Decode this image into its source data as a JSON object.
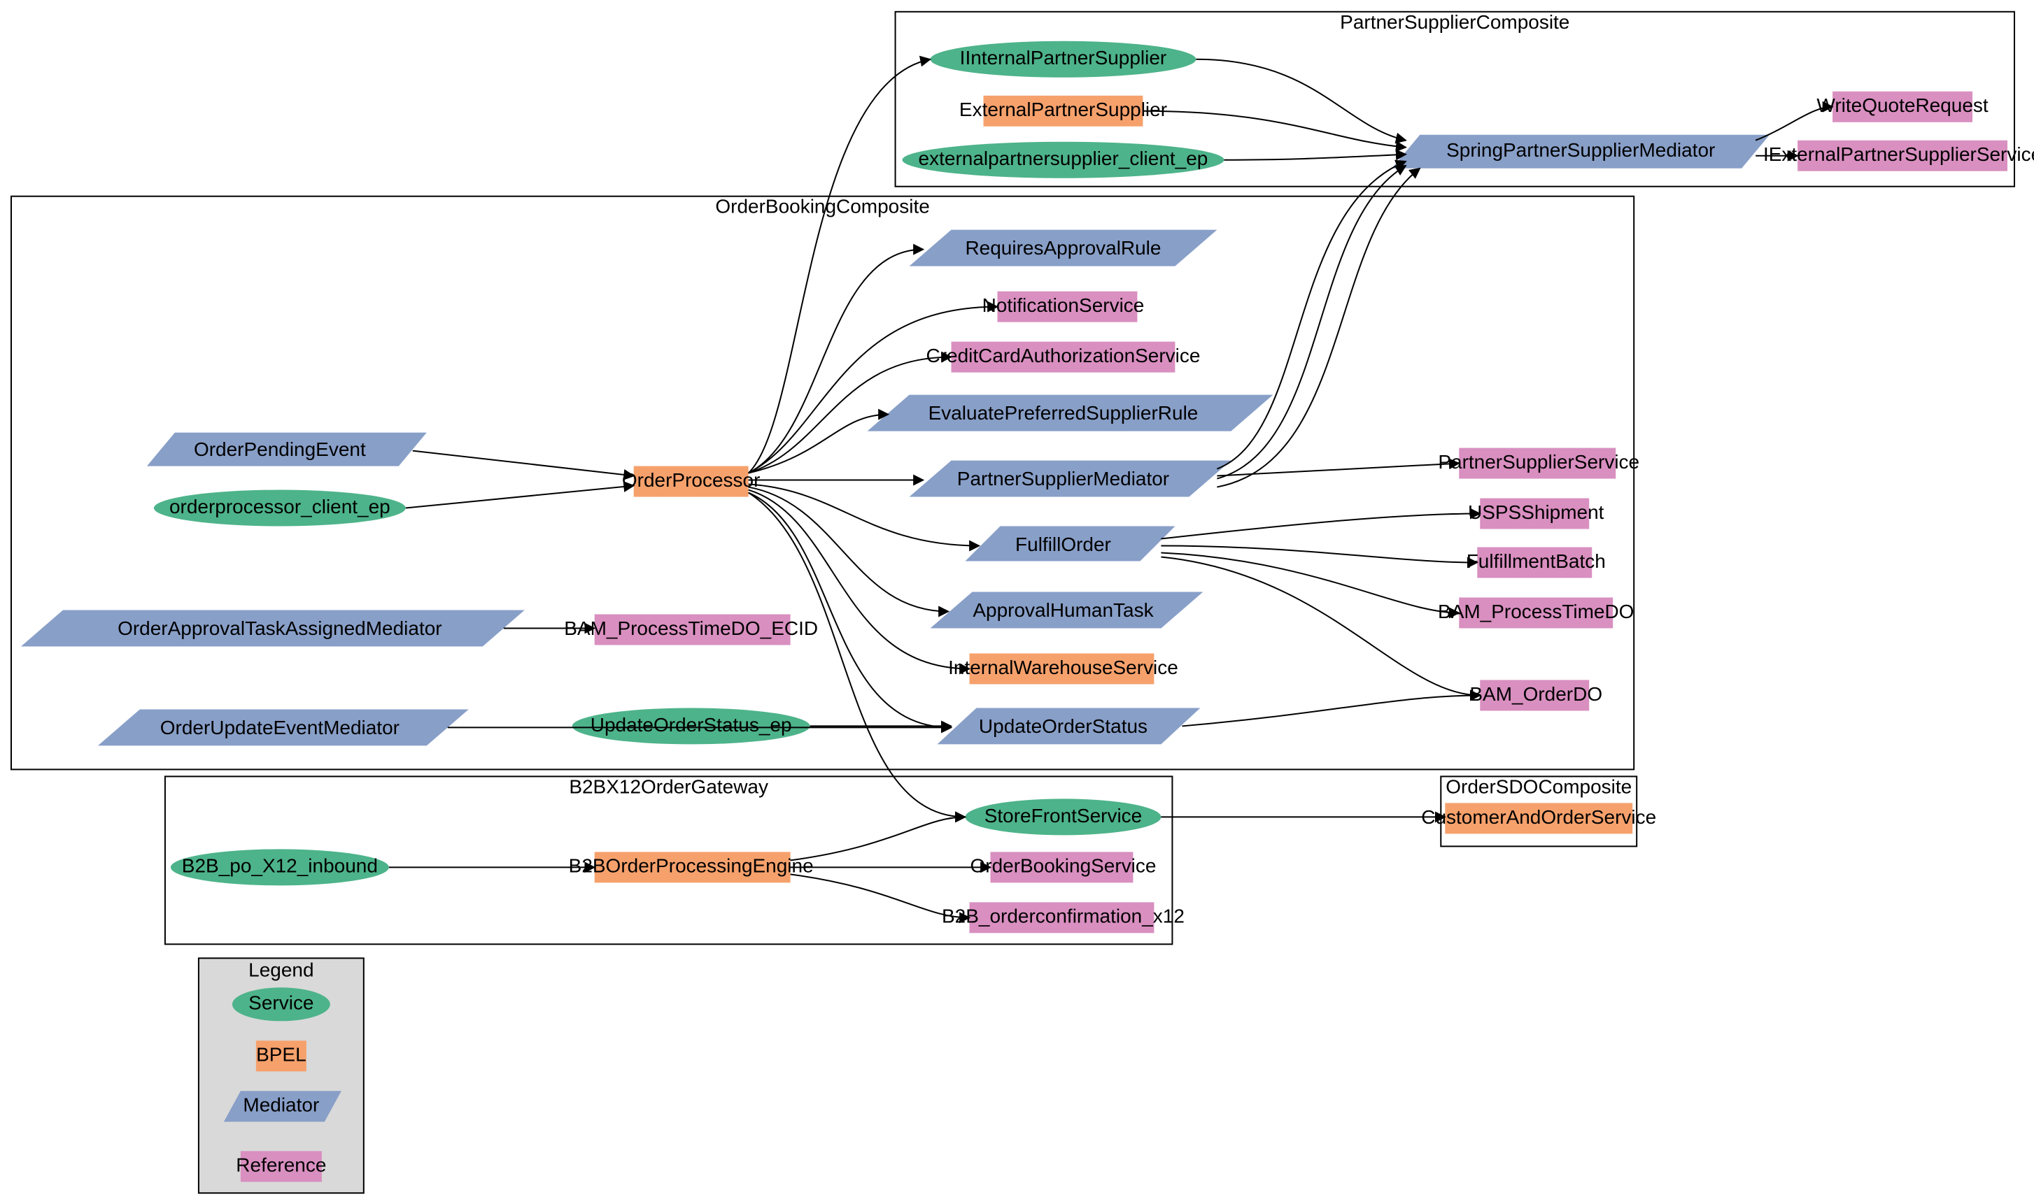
{
  "clusters": {
    "partnerSupplierComposite": "PartnerSupplierComposite",
    "orderBookingComposite": "OrderBookingComposite",
    "b2bGateway": "B2BX12OrderGateway",
    "orderSDOComposite": "OrderSDOComposite",
    "legend": "Legend"
  },
  "nodes": {
    "iinternalPS": "IInternalPartnerSupplier",
    "externalPS": "ExternalPartnerSupplier",
    "extPSclient": "externalpartnersupplier_client_ep",
    "springPSMediator": "SpringPartnerSupplierMediator",
    "writeQuoteReq": "WriteQuoteRequest",
    "iExtPSService": "IExternalPartnerSupplierService",
    "orderPendingEvent": "OrderPendingEvent",
    "orderprocClient": "orderprocessor_client_ep",
    "orderProcessor": "OrderProcessor",
    "requiresApproval": "RequiresApprovalRule",
    "notificationSvc": "NotificationService",
    "ccAuthSvc": "CreditCardAuthorizationService",
    "evalPrefSupplier": "EvaluatePreferredSupplierRule",
    "psMediator": "PartnerSupplierMediator",
    "fulfillOrder": "FulfillOrder",
    "approvalHT": "ApprovalHumanTask",
    "internalWH": "InternalWarehouseService",
    "updateOrderStatus": "UpdateOrderStatus",
    "orderApprovalTAM": "OrderApprovalTaskAssignedMediator",
    "bamECID": "BAM_ProcessTimeDO_ECID",
    "orderUpdateEvtMed": "OrderUpdateEventMediator",
    "updateOrderStatusEp": "UpdateOrderStatus_ep",
    "partnerSupplierSvc": "PartnerSupplierService",
    "uspsShipment": "USPSShipment",
    "fulfillmentBatch": "FulfillmentBatch",
    "bamProcessTimeDO": "BAM_ProcessTimeDO",
    "bamOrderDO": "BAM_OrderDO",
    "b2bInbound": "B2B_po_X12_inbound",
    "b2bEngine": "B2BOrderProcessingEngine",
    "storeFrontSvc": "StoreFrontService",
    "orderBookingSvc": "OrderBookingService",
    "b2bConfirm": "B2B_orderconfirmation_x12",
    "custOrderSvc": "CustomerAndOrderService"
  },
  "legendItems": {
    "service": "Service",
    "bpel": "BPEL",
    "mediator": "Mediator",
    "reference": "Reference"
  },
  "diagram_data": {
    "type": "graph",
    "node_types": {
      "Service": "ellipse, green",
      "BPEL": "rectangle, orange",
      "Mediator": "parallelogram, blue",
      "Reference": "rectangle, pink"
    },
    "clusters": [
      {
        "name": "PartnerSupplierComposite",
        "nodes": [
          {
            "id": "IInternalPartnerSupplier",
            "type": "Service"
          },
          {
            "id": "ExternalPartnerSupplier",
            "type": "BPEL"
          },
          {
            "id": "externalpartnersupplier_client_ep",
            "type": "Service"
          },
          {
            "id": "SpringPartnerSupplierMediator",
            "type": "Mediator"
          },
          {
            "id": "WriteQuoteRequest",
            "type": "Reference"
          },
          {
            "id": "IExternalPartnerSupplierService",
            "type": "Reference"
          }
        ]
      },
      {
        "name": "OrderBookingComposite",
        "nodes": [
          {
            "id": "OrderPendingEvent",
            "type": "Mediator"
          },
          {
            "id": "orderprocessor_client_ep",
            "type": "Service"
          },
          {
            "id": "OrderProcessor",
            "type": "BPEL"
          },
          {
            "id": "RequiresApprovalRule",
            "type": "Mediator"
          },
          {
            "id": "NotificationService",
            "type": "Reference"
          },
          {
            "id": "CreditCardAuthorizationService",
            "type": "Reference"
          },
          {
            "id": "EvaluatePreferredSupplierRule",
            "type": "Mediator"
          },
          {
            "id": "PartnerSupplierMediator",
            "type": "Mediator"
          },
          {
            "id": "FulfillOrder",
            "type": "Mediator"
          },
          {
            "id": "ApprovalHumanTask",
            "type": "Mediator"
          },
          {
            "id": "InternalWarehouseService",
            "type": "BPEL"
          },
          {
            "id": "UpdateOrderStatus",
            "type": "Mediator"
          },
          {
            "id": "OrderApprovalTaskAssignedMediator",
            "type": "Mediator"
          },
          {
            "id": "BAM_ProcessTimeDO_ECID",
            "type": "Reference"
          },
          {
            "id": "OrderUpdateEventMediator",
            "type": "Mediator"
          },
          {
            "id": "UpdateOrderStatus_ep",
            "type": "Service"
          },
          {
            "id": "PartnerSupplierService",
            "type": "Reference"
          },
          {
            "id": "USPSShipment",
            "type": "Reference"
          },
          {
            "id": "FulfillmentBatch",
            "type": "Reference"
          },
          {
            "id": "BAM_ProcessTimeDO",
            "type": "Reference"
          },
          {
            "id": "BAM_OrderDO",
            "type": "Reference"
          }
        ]
      },
      {
        "name": "B2BX12OrderGateway",
        "nodes": [
          {
            "id": "B2B_po_X12_inbound",
            "type": "Service"
          },
          {
            "id": "B2BOrderProcessingEngine",
            "type": "BPEL"
          },
          {
            "id": "StoreFrontService",
            "type": "Service"
          },
          {
            "id": "OrderBookingService",
            "type": "Reference"
          },
          {
            "id": "B2B_orderconfirmation_x12",
            "type": "Reference"
          }
        ]
      },
      {
        "name": "OrderSDOComposite",
        "nodes": [
          {
            "id": "CustomerAndOrderService",
            "type": "BPEL"
          }
        ]
      }
    ],
    "edges": [
      [
        "IInternalPartnerSupplier",
        "SpringPartnerSupplierMediator"
      ],
      [
        "ExternalPartnerSupplier",
        "SpringPartnerSupplierMediator"
      ],
      [
        "externalpartnersupplier_client_ep",
        "SpringPartnerSupplierMediator"
      ],
      [
        "SpringPartnerSupplierMediator",
        "WriteQuoteRequest"
      ],
      [
        "SpringPartnerSupplierMediator",
        "IExternalPartnerSupplierService"
      ],
      [
        "OrderPendingEvent",
        "OrderProcessor"
      ],
      [
        "orderprocessor_client_ep",
        "OrderProcessor"
      ],
      [
        "OrderProcessor",
        "IInternalPartnerSupplier"
      ],
      [
        "OrderProcessor",
        "RequiresApprovalRule"
      ],
      [
        "OrderProcessor",
        "NotificationService"
      ],
      [
        "OrderProcessor",
        "CreditCardAuthorizationService"
      ],
      [
        "OrderProcessor",
        "EvaluatePreferredSupplierRule"
      ],
      [
        "OrderProcessor",
        "PartnerSupplierMediator"
      ],
      [
        "OrderProcessor",
        "FulfillOrder"
      ],
      [
        "OrderProcessor",
        "ApprovalHumanTask"
      ],
      [
        "OrderProcessor",
        "InternalWarehouseService"
      ],
      [
        "OrderProcessor",
        "UpdateOrderStatus"
      ],
      [
        "OrderProcessor",
        "StoreFrontService"
      ],
      [
        "PartnerSupplierMediator",
        "SpringPartnerSupplierMediator"
      ],
      [
        "PartnerSupplierMediator",
        "SpringPartnerSupplierMediator"
      ],
      [
        "PartnerSupplierMediator",
        "SpringPartnerSupplierMediator"
      ],
      [
        "PartnerSupplierMediator",
        "PartnerSupplierService"
      ],
      [
        "FulfillOrder",
        "USPSShipment"
      ],
      [
        "FulfillOrder",
        "FulfillmentBatch"
      ],
      [
        "FulfillOrder",
        "BAM_ProcessTimeDO"
      ],
      [
        "FulfillOrder",
        "BAM_OrderDO"
      ],
      [
        "OrderApprovalTaskAssignedMediator",
        "BAM_ProcessTimeDO_ECID"
      ],
      [
        "OrderUpdateEventMediator",
        "UpdateOrderStatus"
      ],
      [
        "UpdateOrderStatus_ep",
        "UpdateOrderStatus"
      ],
      [
        "UpdateOrderStatus",
        "BAM_OrderDO"
      ],
      [
        "B2B_po_X12_inbound",
        "B2BOrderProcessingEngine"
      ],
      [
        "B2BOrderProcessingEngine",
        "StoreFrontService"
      ],
      [
        "B2BOrderProcessingEngine",
        "OrderBookingService"
      ],
      [
        "B2BOrderProcessingEngine",
        "B2B_orderconfirmation_x12"
      ],
      [
        "StoreFrontService",
        "CustomerAndOrderService"
      ]
    ]
  }
}
